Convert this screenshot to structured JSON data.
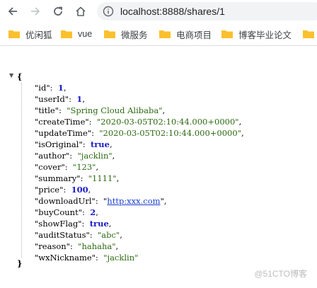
{
  "browser": {
    "url": "localhost:8888/shares/1"
  },
  "bookmarks": [
    {
      "label": "优闲狐"
    },
    {
      "label": "vue"
    },
    {
      "label": "微服务"
    },
    {
      "label": "电商项目"
    },
    {
      "label": "博客毕业论文"
    },
    {
      "label": ""
    }
  ],
  "json": {
    "open_brace": "{",
    "close_brace": "}",
    "fields": [
      {
        "key": "\"id\"",
        "value": "1",
        "type": "num"
      },
      {
        "key": "\"userId\"",
        "value": "1",
        "type": "num"
      },
      {
        "key": "\"title\"",
        "value": "\"Spring Cloud Alibaba\"",
        "type": "str"
      },
      {
        "key": "\"createTime\"",
        "value": "\"2020-03-05T02:10:44.000+0000\"",
        "type": "str"
      },
      {
        "key": "\"updateTime\"",
        "value": "\"2020-03-05T02:10:44.000+0000\"",
        "type": "str"
      },
      {
        "key": "\"isOriginal\"",
        "value": "true",
        "type": "bool"
      },
      {
        "key": "\"author\"",
        "value": "\"jacklin\"",
        "type": "str"
      },
      {
        "key": "\"cover\"",
        "value": "\"123\"",
        "type": "str"
      },
      {
        "key": "\"summary\"",
        "value": "\"1111\"",
        "type": "str"
      },
      {
        "key": "\"price\"",
        "value": "100",
        "type": "num"
      },
      {
        "key": "\"downloadUrl\"",
        "value": "http:xxx.com",
        "type": "link"
      },
      {
        "key": "\"buyCount\"",
        "value": "2",
        "type": "num"
      },
      {
        "key": "\"showFlag\"",
        "value": "true",
        "type": "bool"
      },
      {
        "key": "\"auditStatus\"",
        "value": "\"abc\"",
        "type": "str"
      },
      {
        "key": "\"reason\"",
        "value": "\"hahaha\"",
        "type": "str"
      },
      {
        "key": "\"wxNickname\"",
        "value": "\"jacklin\"",
        "type": "str"
      }
    ]
  },
  "watermark": "@51CTO博客"
}
